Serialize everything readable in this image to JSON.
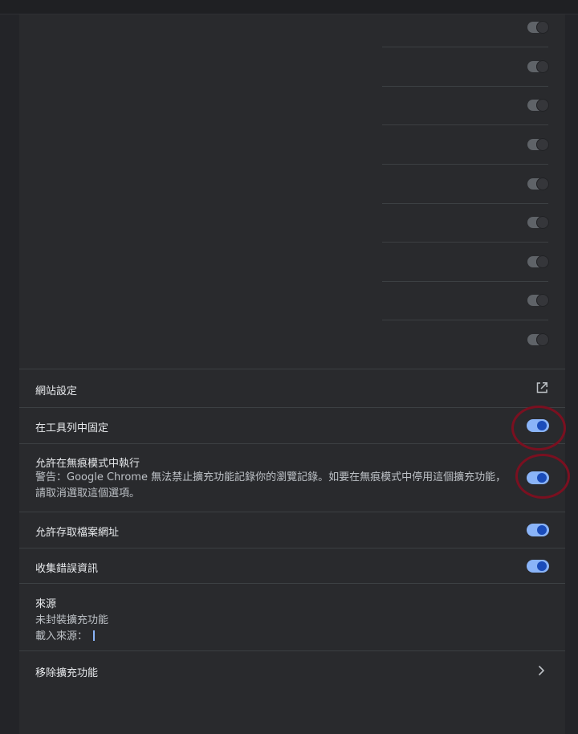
{
  "site_settings": {
    "label": "網站設定",
    "icon": "open-in-new-icon"
  },
  "pin_toolbar": {
    "label": "在工具列中固定",
    "enabled": true
  },
  "incognito": {
    "label": "允許在無痕模式中執行",
    "warning": "警告：Google Chrome 無法禁止擴充功能記錄你的瀏覽記錄。如要在無痕模式中停用這個擴充功能，請取消選取這個選項。",
    "enabled": true
  },
  "file_urls": {
    "label": "允許存取檔案網址",
    "enabled": true
  },
  "errors": {
    "label": "收集錯誤資訊",
    "enabled": true
  },
  "source": {
    "title": "來源",
    "type": "未封裝擴充功能",
    "load_from": "載入來源："
  },
  "remove": {
    "label": "移除擴充功能",
    "icon": "chevron-right-icon"
  },
  "colors": {
    "accent": "#8ab4f8",
    "annotation": "#7a1020",
    "background": "#292a2d"
  }
}
